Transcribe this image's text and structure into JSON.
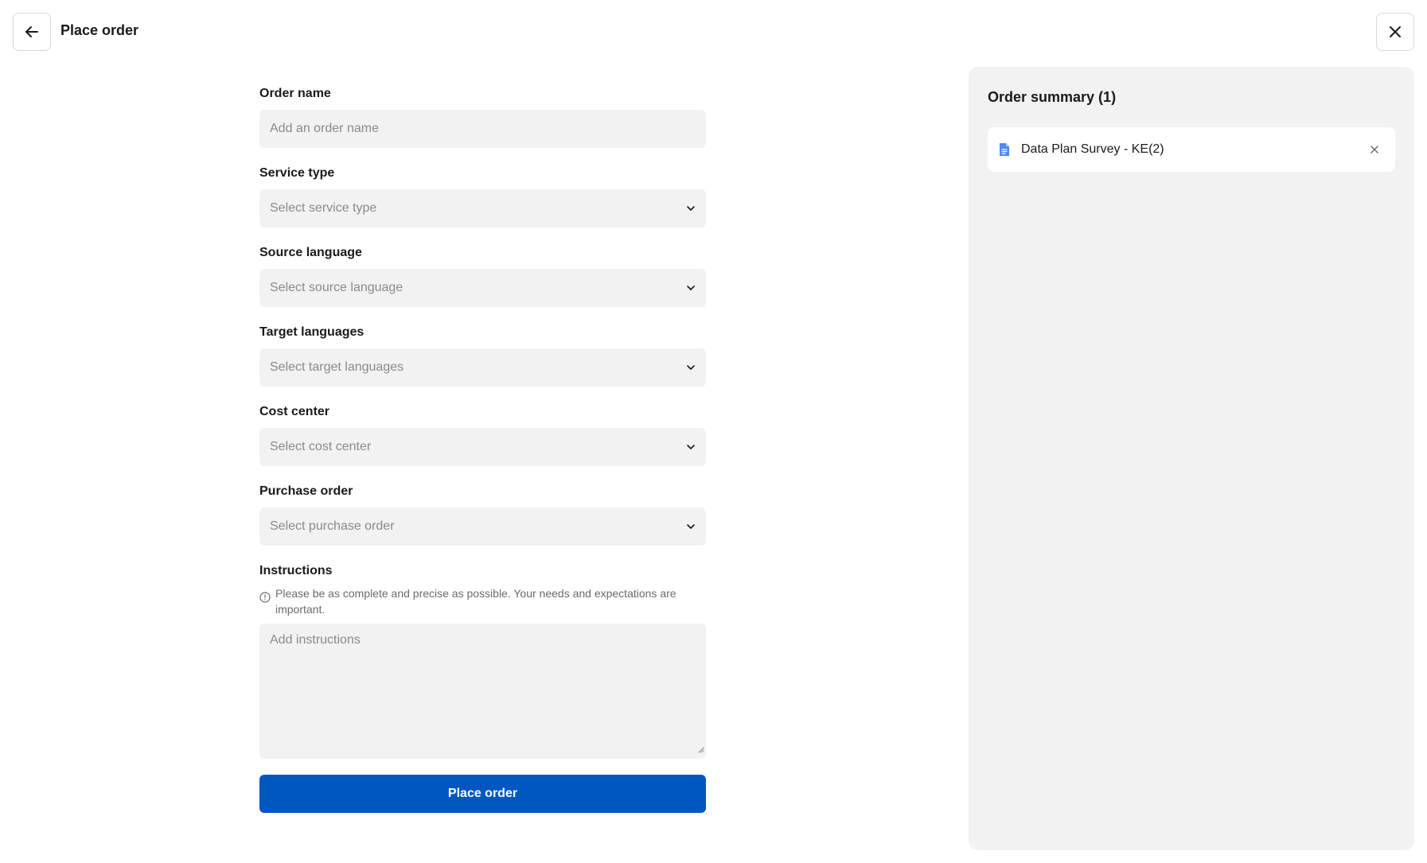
{
  "header": {
    "title": "Place order"
  },
  "form": {
    "order_name": {
      "label": "Order name",
      "placeholder": "Add an order name"
    },
    "service_type": {
      "label": "Service type",
      "placeholder": "Select service type"
    },
    "source_language": {
      "label": "Source language",
      "placeholder": "Select source language"
    },
    "target_languages": {
      "label": "Target languages",
      "placeholder": "Select target languages"
    },
    "cost_center": {
      "label": "Cost center",
      "placeholder": "Select cost center"
    },
    "purchase_order": {
      "label": "Purchase order",
      "placeholder": "Select purchase order"
    },
    "instructions": {
      "label": "Instructions",
      "hint": "Please be as complete and precise as possible. Your needs and expectations are important.",
      "placeholder": "Add instructions"
    },
    "submit_label": "Place order"
  },
  "summary": {
    "title": "Order summary (1)",
    "items": [
      {
        "name": "Data Plan Survey - KE(2)",
        "icon": "document-icon"
      }
    ]
  },
  "colors": {
    "primary": "#0057bf",
    "field_bg": "#f2f2f2",
    "panel_bg": "#f2f2f2",
    "doc_icon": "#4a8af4"
  }
}
